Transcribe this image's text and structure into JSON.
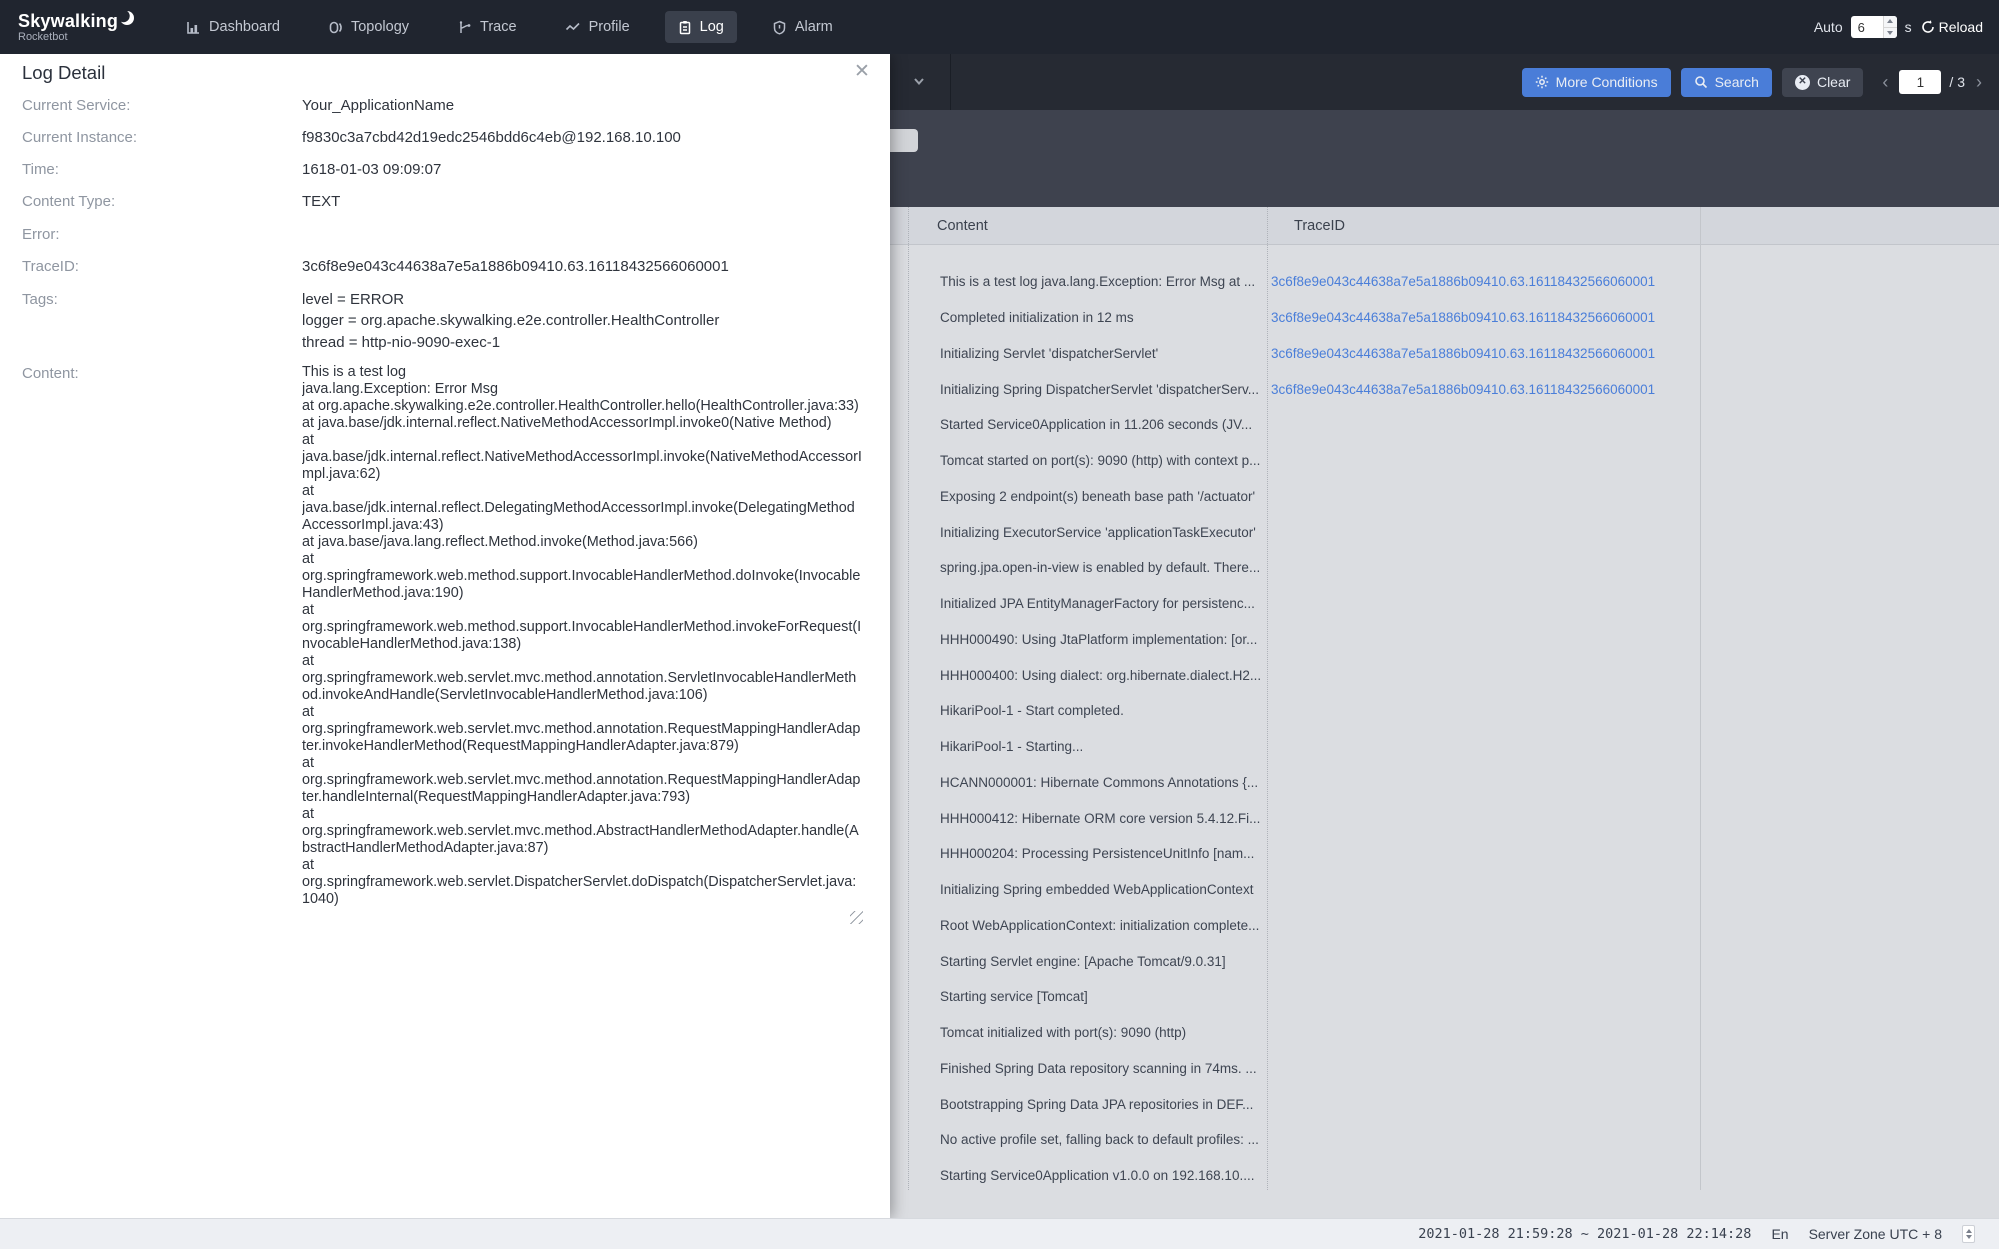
{
  "nav": {
    "brand": {
      "title": "Skywalking",
      "subtitle": "Rocketbot"
    },
    "items": [
      {
        "label": "Dashboard"
      },
      {
        "label": "Topology"
      },
      {
        "label": "Trace"
      },
      {
        "label": "Profile"
      },
      {
        "label": "Log"
      },
      {
        "label": "Alarm"
      }
    ],
    "auto_label": "Auto",
    "auto_value": "6",
    "auto_unit": "s",
    "reload_label": "Reload"
  },
  "toolbar": {
    "more_conditions_label": "More Conditions",
    "search_label": "Search",
    "clear_label": "Clear",
    "page_value": "1",
    "page_total": "/ 3"
  },
  "log_detail": {
    "title": "Log Detail",
    "fields": [
      {
        "label": "Current Service:",
        "value": "Your_ApplicationName"
      },
      {
        "label": "Current Instance:",
        "value": "f9830c3a7cbd42d19edc2546bdd6c4eb@192.168.10.100"
      },
      {
        "label": "Time:",
        "value": "1618-01-03 09:09:07"
      },
      {
        "label": "Content Type:",
        "value": "TEXT"
      },
      {
        "label": "Error:",
        "value": ""
      },
      {
        "label": "TraceID:",
        "value": "3c6f8e9e043c44638a7e5a1886b09410.63.16118432566060001"
      }
    ],
    "tags_label": "Tags:",
    "tags": [
      "level = ERROR",
      "logger = org.apache.skywalking.e2e.controller.HealthController",
      "thread = http-nio-9090-exec-1"
    ],
    "content_label": "Content:",
    "content": "This is a test log\njava.lang.Exception: Error Msg\nat org.apache.skywalking.e2e.controller.HealthController.hello(HealthController.java:33)\nat java.base/jdk.internal.reflect.NativeMethodAccessorImpl.invoke0(Native Method)\nat java.base/jdk.internal.reflect.NativeMethodAccessorImpl.invoke(NativeMethodAccessorImpl.java:62)\nat java.base/jdk.internal.reflect.DelegatingMethodAccessorImpl.invoke(DelegatingMethodAccessorImpl.java:43)\nat java.base/java.lang.reflect.Method.invoke(Method.java:566)\nat org.springframework.web.method.support.InvocableHandlerMethod.doInvoke(InvocableHandlerMethod.java:190)\nat org.springframework.web.method.support.InvocableHandlerMethod.invokeForRequest(InvocableHandlerMethod.java:138)\nat org.springframework.web.servlet.mvc.method.annotation.ServletInvocableHandlerMethod.invokeAndHandle(ServletInvocableHandlerMethod.java:106)\nat org.springframework.web.servlet.mvc.method.annotation.RequestMappingHandlerAdapter.invokeHandlerMethod(RequestMappingHandlerAdapter.java:879)\nat org.springframework.web.servlet.mvc.method.annotation.RequestMappingHandlerAdapter.handleInternal(RequestMappingHandlerAdapter.java:793)\nat org.springframework.web.servlet.mvc.method.AbstractHandlerMethodAdapter.handle(AbstractHandlerMethodAdapter.java:87)\nat org.springframework.web.servlet.DispatcherServlet.doDispatch(DispatcherServlet.java:1040)"
  },
  "table": {
    "columns": [
      "Content",
      "TraceID"
    ],
    "rows": [
      {
        "content": "This is a test log java.lang.Exception: Error Msg at ...",
        "trace_id": "3c6f8e9e043c44638a7e5a1886b09410.63.16118432566060001"
      },
      {
        "content": "Completed initialization in 12 ms",
        "trace_id": "3c6f8e9e043c44638a7e5a1886b09410.63.16118432566060001"
      },
      {
        "content": "Initializing Servlet 'dispatcherServlet'",
        "trace_id": "3c6f8e9e043c44638a7e5a1886b09410.63.16118432566060001"
      },
      {
        "content": "Initializing Spring DispatcherServlet 'dispatcherServ...",
        "trace_id": "3c6f8e9e043c44638a7e5a1886b09410.63.16118432566060001"
      },
      {
        "content": "Started Service0Application in 11.206 seconds (JV...",
        "trace_id": ""
      },
      {
        "content": "Tomcat started on port(s): 9090 (http) with context p...",
        "trace_id": ""
      },
      {
        "content": "Exposing 2 endpoint(s) beneath base path '/actuator'",
        "trace_id": ""
      },
      {
        "content": "Initializing ExecutorService 'applicationTaskExecutor'",
        "trace_id": ""
      },
      {
        "content": "spring.jpa.open-in-view is enabled by default. There...",
        "trace_id": ""
      },
      {
        "content": "Initialized JPA EntityManagerFactory for persistenc...",
        "trace_id": ""
      },
      {
        "content": "HHH000490: Using JtaPlatform implementation: [or...",
        "trace_id": ""
      },
      {
        "content": "HHH000400: Using dialect: org.hibernate.dialect.H2...",
        "trace_id": ""
      },
      {
        "content": "HikariPool-1 - Start completed.",
        "trace_id": ""
      },
      {
        "content": "HikariPool-1 - Starting...",
        "trace_id": ""
      },
      {
        "content": "HCANN000001: Hibernate Commons Annotations {...",
        "trace_id": ""
      },
      {
        "content": "HHH000412: Hibernate ORM core version 5.4.12.Fi...",
        "trace_id": ""
      },
      {
        "content": "HHH000204: Processing PersistenceUnitInfo [nam...",
        "trace_id": ""
      },
      {
        "content": "Initializing Spring embedded WebApplicationContext",
        "trace_id": ""
      },
      {
        "content": "Root WebApplicationContext: initialization complete...",
        "trace_id": ""
      },
      {
        "content": "Starting Servlet engine: [Apache Tomcat/9.0.31]",
        "trace_id": ""
      },
      {
        "content": "Starting service [Tomcat]",
        "trace_id": ""
      },
      {
        "content": "Tomcat initialized with port(s): 9090 (http)",
        "trace_id": ""
      },
      {
        "content": "Finished Spring Data repository scanning in 74ms. ...",
        "trace_id": ""
      },
      {
        "content": "Bootstrapping Spring Data JPA repositories in DEF...",
        "trace_id": ""
      },
      {
        "content": "No active profile set, falling back to default profiles: ...",
        "trace_id": ""
      },
      {
        "content": "Starting Service0Application v1.0.0 on 192.168.10....",
        "trace_id": ""
      }
    ]
  },
  "footer": {
    "time_range": "2021-01-28 21:59:28 ~ 2021-01-28 22:14:28",
    "language": "En",
    "server_zone": "Server Zone UTC + 8"
  },
  "colors": {
    "nav_bg": "#20252f",
    "toolbar_bg": "#262a33",
    "panel_bg": "#3e424e",
    "primary_blue": "#4a7dd8",
    "link_blue": "#4a7ed9",
    "table_header_bg": "#d3d6dc",
    "table_body_bg": "#dbdde1"
  }
}
